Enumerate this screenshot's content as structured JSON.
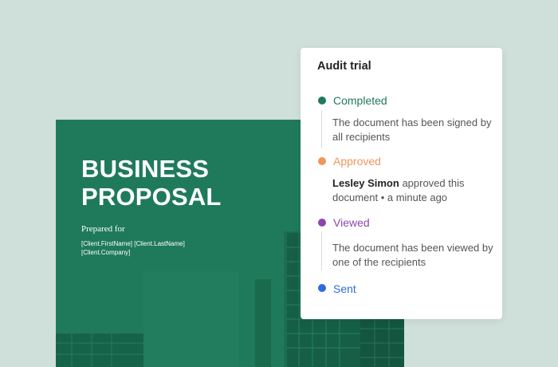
{
  "document": {
    "title_line1": "BUSINESS",
    "title_line2": "PROPOSAL",
    "prepared_for": "Prepared for",
    "client_name": "[Client.FirstName] [Client.LastName]",
    "client_company": "[Client.Company]",
    "cover_color": "#1f7a5b"
  },
  "audit": {
    "title": "Audit trial",
    "steps": [
      {
        "label": "Completed",
        "color": "#1f7a5b",
        "desc": "The document has been signed by all recipients"
      },
      {
        "label": "Approved",
        "color": "#f0965a",
        "actor": "Lesley Simon",
        "desc": "approved this document • a minute ago"
      },
      {
        "label": "Viewed",
        "color": "#8e44ad",
        "desc": "The document has been viewed by one of the recipients"
      },
      {
        "label": "Sent",
        "color": "#2d6be0"
      }
    ]
  }
}
